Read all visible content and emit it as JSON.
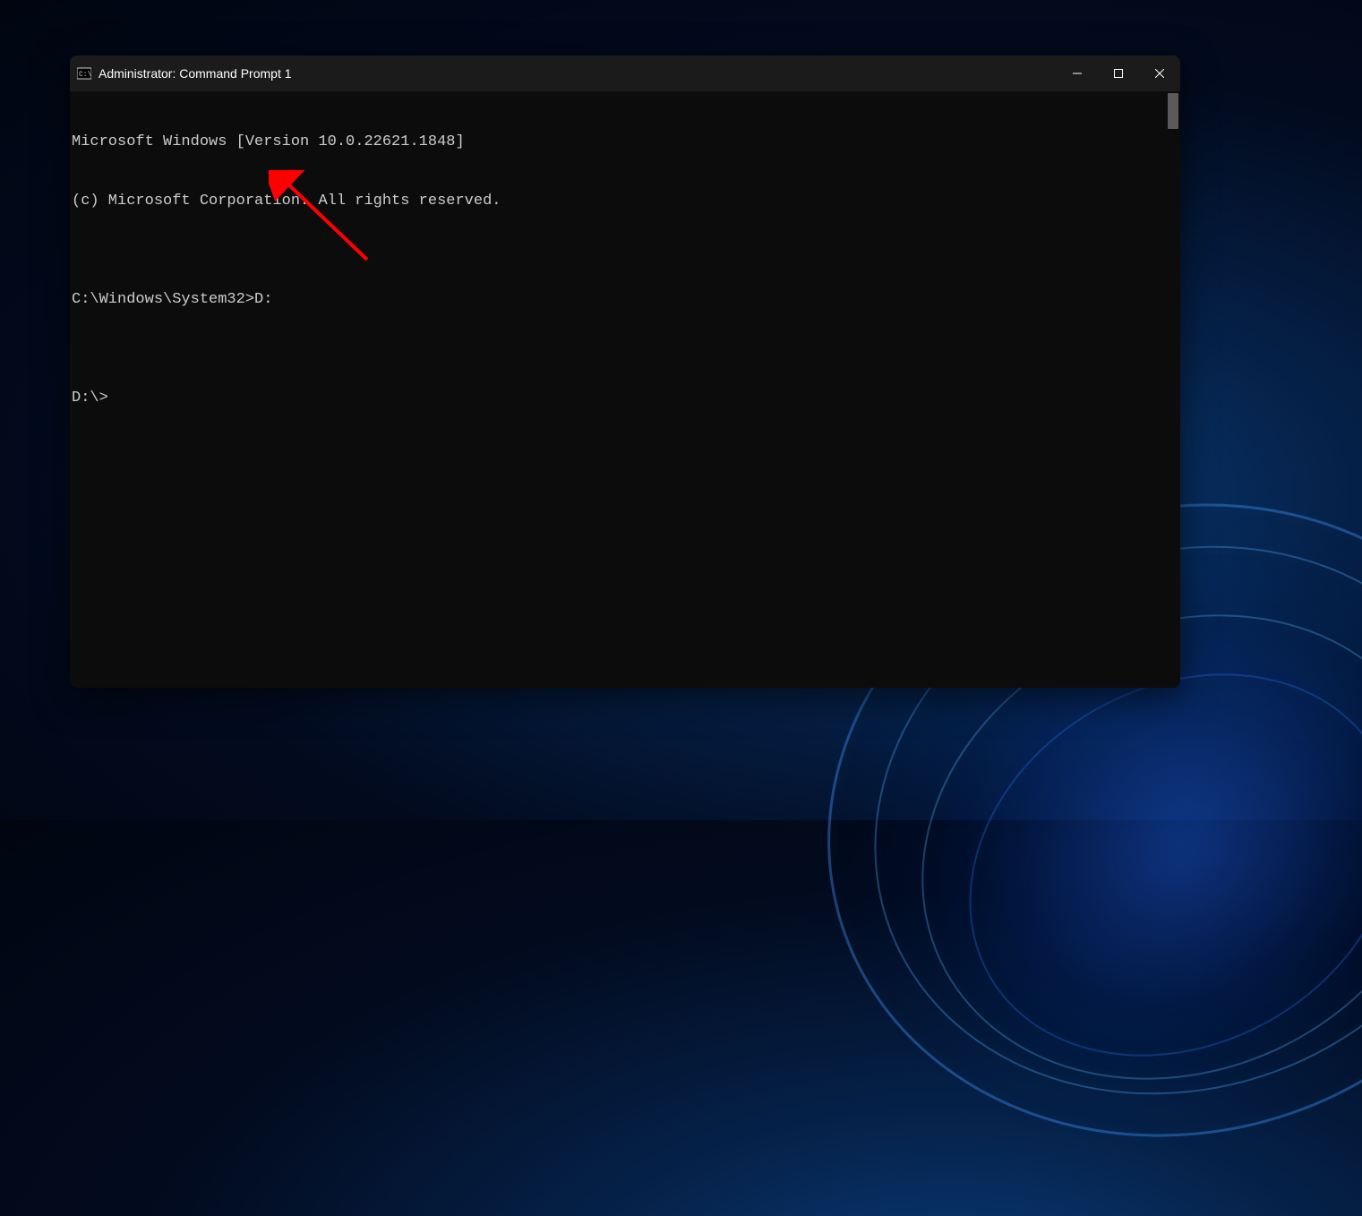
{
  "window": {
    "title": "Administrator: Command Prompt 1"
  },
  "terminal": {
    "lines": [
      "Microsoft Windows [Version 10.0.22621.1848]",
      "(c) Microsoft Corporation. All rights reserved.",
      "",
      "C:\\Windows\\System32>D:",
      "",
      "D:\\>"
    ]
  }
}
